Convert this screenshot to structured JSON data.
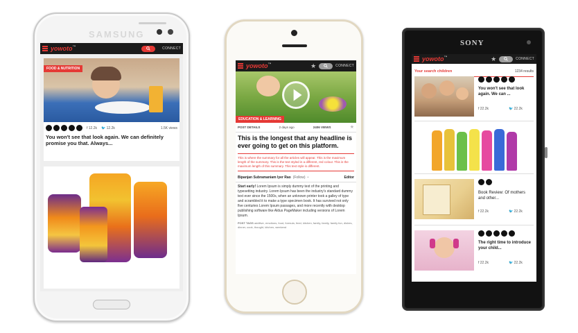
{
  "phone1": {
    "brand": "SAMSUNG",
    "logo": "yowoto",
    "connect": "CONNECT",
    "category": "FOOD & NUTRITION",
    "share_count": "12.2k",
    "views": "1.5K views",
    "headline": "You won't see that look again. We can definitely promise you that. Always..."
  },
  "phone2": {
    "logo": "yowoto",
    "connect": "CONNECT",
    "category": "EDUCATION & LEARNING",
    "meta_left": "POST DETAILS",
    "meta_mid": "2 days ago",
    "meta_right": "2406 VIEWS",
    "headline": "This is the longest that any headline is ever  going to get on this platform.",
    "summary": "This is where the summary for all the articles will appear. This is the maximum length of the summary. This is the text styled in a different, red colour. This is the maximum length of this summary. This text style is different.",
    "author": "Bipanjan Subramaniam Iyer Rao",
    "follow": "(Follow)",
    "editor": "Editor",
    "body_lead": "Start early!",
    "body": "Lorem Ipsum is simply dummy text of the printing and typesetting industry. Lorem Ipsum has been the industry's standard dummy text ever since the 1500s, when an unknown printer took a galley of type and scrambled it to make a type specimen book. It has survived not only five centuries Lorem Ipsum passages, and more recently with desktop publishing software like Aldus PageMaker including versions of Lorem Ipsum.",
    "tags_label": "POST TAGS",
    "tags": "additive, emotions, food, formula, feed, kitchen, family, family, family fun, dishes, dinner, cook, thought, kitchen, weekend"
  },
  "phone3": {
    "brand": "SONY",
    "logo": "yowoto",
    "connect": "CONNECT",
    "section": "Your search children",
    "results": "1234 results",
    "card1_title": "You won't see that look again. We can ...",
    "card3_title": "Book Review: Of mothers and other...",
    "card4_title": "The right time to introduce your child...",
    "count": "22.2k"
  },
  "colors": {
    "accent": "#e53935",
    "appbar": "#1b1b1b"
  }
}
